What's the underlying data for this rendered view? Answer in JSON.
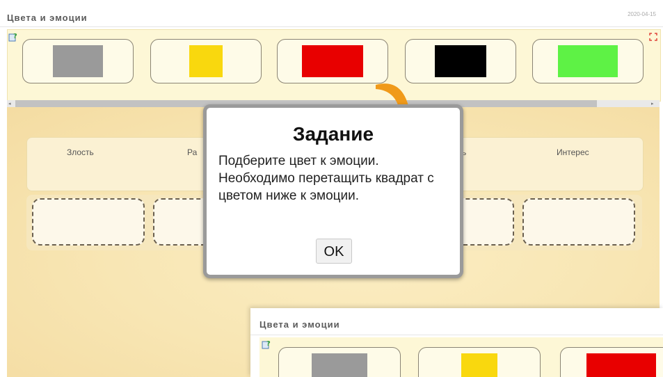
{
  "header": {
    "title": "Цвета и эмоции",
    "date": "2020-04-15"
  },
  "colors": {
    "swatches": [
      "#9a9a9a",
      "#f9d80e",
      "#e80000",
      "#000000",
      "#5ef245"
    ],
    "accent_orange": "#f09a1a"
  },
  "emotions": [
    "Злость",
    "Ра",
    "ь",
    "Интерес"
  ],
  "dialog": {
    "title": "Задание",
    "body": "Подберите цвет к эмоции. Необходимо перетащить квадрат с цветом ниже к эмоции.",
    "ok_label": "OK"
  },
  "second_screenshot": {
    "title": "Цвета и эмоции"
  }
}
